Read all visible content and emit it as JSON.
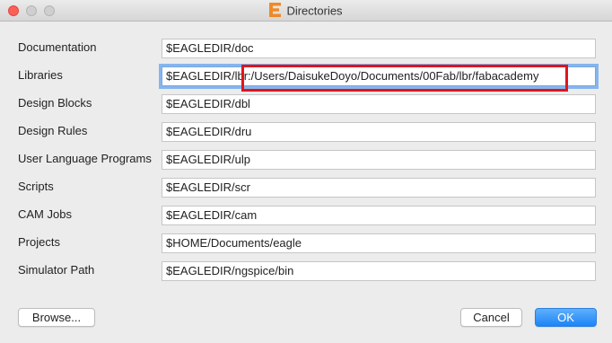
{
  "window": {
    "title": "Directories"
  },
  "rows": [
    {
      "label": "Documentation",
      "value": "$EAGLEDIR/doc"
    },
    {
      "label": "Libraries",
      "value": "$EAGLEDIR/lbr:/Users/DaisukeDoyo/Documents/00Fab/lbr/fabacademy"
    },
    {
      "label": "Design Blocks",
      "value": "$EAGLEDIR/dbl"
    },
    {
      "label": "Design Rules",
      "value": "$EAGLEDIR/dru"
    },
    {
      "label": "User Language Programs",
      "value": "$EAGLEDIR/ulp"
    },
    {
      "label": "Scripts",
      "value": "$EAGLEDIR/scr"
    },
    {
      "label": "CAM Jobs",
      "value": "$EAGLEDIR/cam"
    },
    {
      "label": "Projects",
      "value": "$HOME/Documents/eagle"
    },
    {
      "label": "Simulator Path",
      "value": "$EAGLEDIR/ngspice/bin"
    }
  ],
  "buttons": {
    "browse": "Browse...",
    "cancel": "Cancel",
    "ok": "OK"
  },
  "colors": {
    "accent": "#1c84f7",
    "highlight": "#e0151b",
    "app_icon": "#f08a24"
  }
}
